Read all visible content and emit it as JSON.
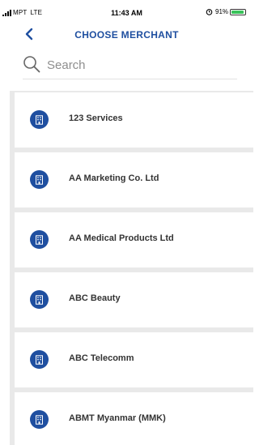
{
  "status_bar": {
    "carrier": "MPT",
    "network": "LTE",
    "time": "11:43 AM",
    "battery": "91%",
    "battery_level": 0.91,
    "icons": [
      "signal-icon",
      "alarm-icon",
      "battery-icon"
    ]
  },
  "header": {
    "title": "CHOOSE MERCHANT",
    "back_icon": "chevron-left-icon"
  },
  "search": {
    "placeholder": "Search",
    "value": "",
    "icon": "search-icon"
  },
  "merchants": {
    "items": [
      {
        "name": "123 Services",
        "icon": "building-icon"
      },
      {
        "name": "AA Marketing Co. Ltd",
        "icon": "building-icon"
      },
      {
        "name": "AA Medical Products Ltd",
        "icon": "building-icon"
      },
      {
        "name": "ABC Beauty",
        "icon": "building-icon"
      },
      {
        "name": "ABC Telecomm",
        "icon": "building-icon"
      },
      {
        "name": "ABMT Myanmar (MMK)",
        "icon": "building-icon"
      }
    ]
  },
  "colors": {
    "accent": "#1f4fa0",
    "list_background": "#e9e9e9",
    "text": "#333333",
    "battery": "#39c25a"
  }
}
